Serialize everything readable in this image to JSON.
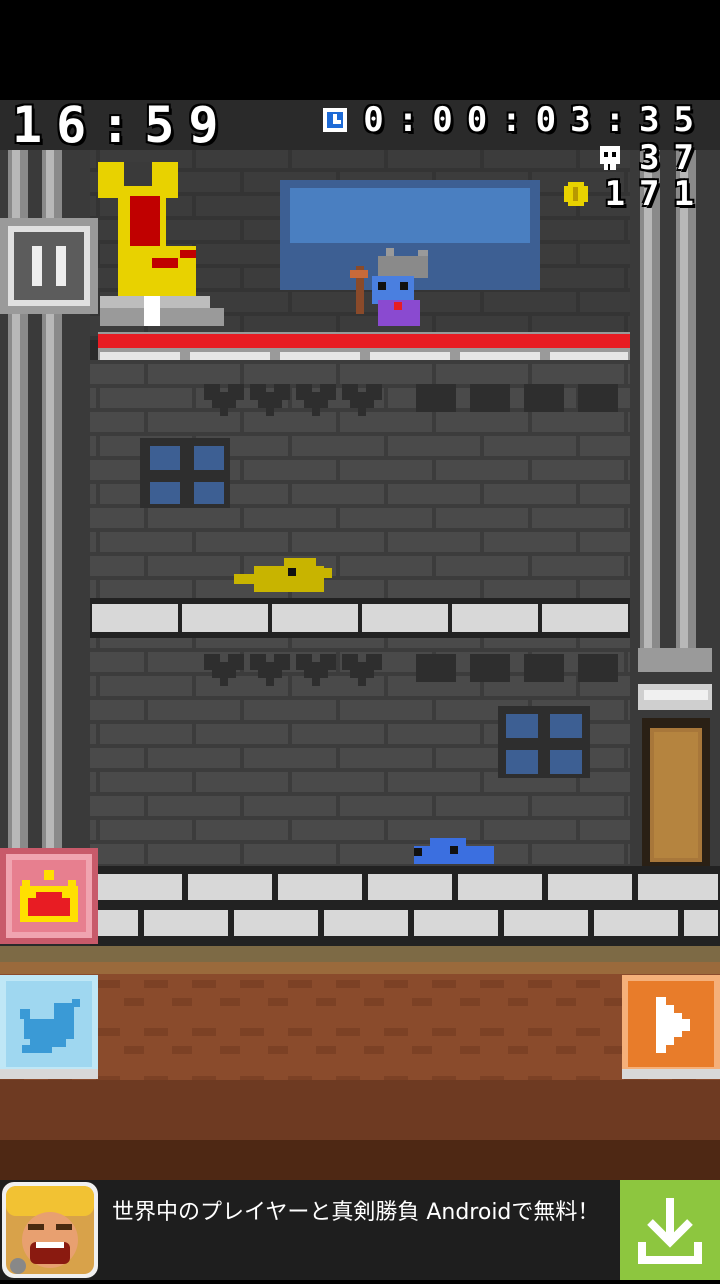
{
  "hud": {
    "clock": "16:59",
    "elapsed_timer": "0:00:03:35",
    "death_count": "37",
    "coin_count": "171"
  },
  "icons": {
    "timer": "stopwatch-icon",
    "deaths": "skull-icon",
    "coins": "coin-icon",
    "pause": "pause-icon",
    "crown": "crown-icon",
    "twitter": "twitter-bird-icon",
    "play": "play-icon",
    "download": "download-icon"
  },
  "ad": {
    "text": "世界中のプレイヤーと真剣勝負 Androidで無料！"
  },
  "colors": {
    "wall": "#4a4a4a",
    "brick_line": "#3a3a3a",
    "pillar": "#8a8a8a",
    "red_platform": "#e81c23",
    "dirt": "#8a4b2c",
    "window_blue": "#4a7fc1",
    "blue_slime": "#3b6fe0",
    "yellow_creature": "#c8b400",
    "ad_download_green": "#8dc63f",
    "play_button_orange": "#e87c2a",
    "twitter_blue": "#9fd7f0"
  }
}
